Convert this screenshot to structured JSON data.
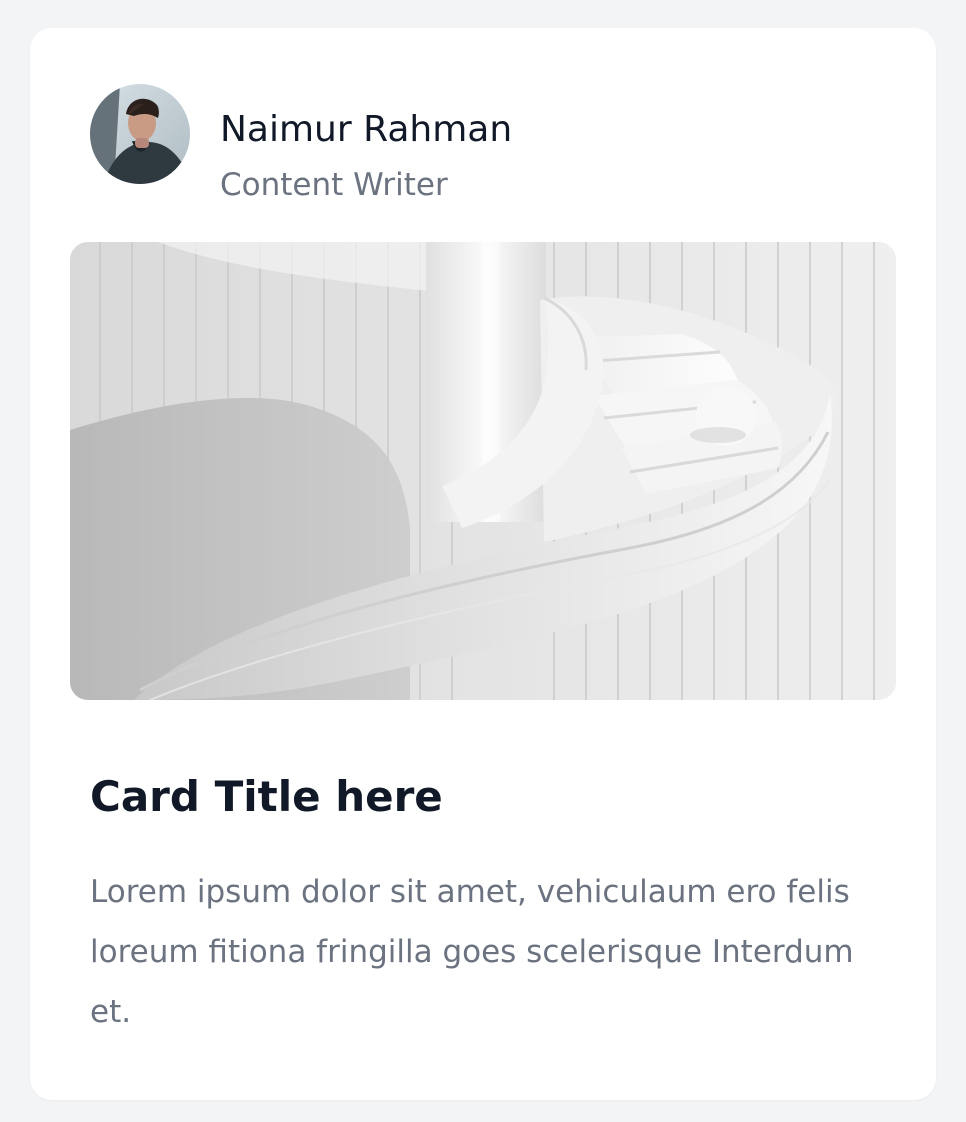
{
  "author": {
    "name": "Naimur Rahman",
    "role": "Content Writer"
  },
  "card": {
    "title": "Card Title here",
    "description": "Lorem ipsum dolor sit amet, vehiculaum ero felis loreum fitiona fringilla goes scelerisque Interdum et."
  },
  "colors": {
    "background": "#f3f4f6",
    "card": "#ffffff",
    "title_text": "#111827",
    "muted_text": "#6b7280"
  },
  "icons": {
    "avatar": "avatar-portrait",
    "image": "spiral-staircase-image"
  }
}
